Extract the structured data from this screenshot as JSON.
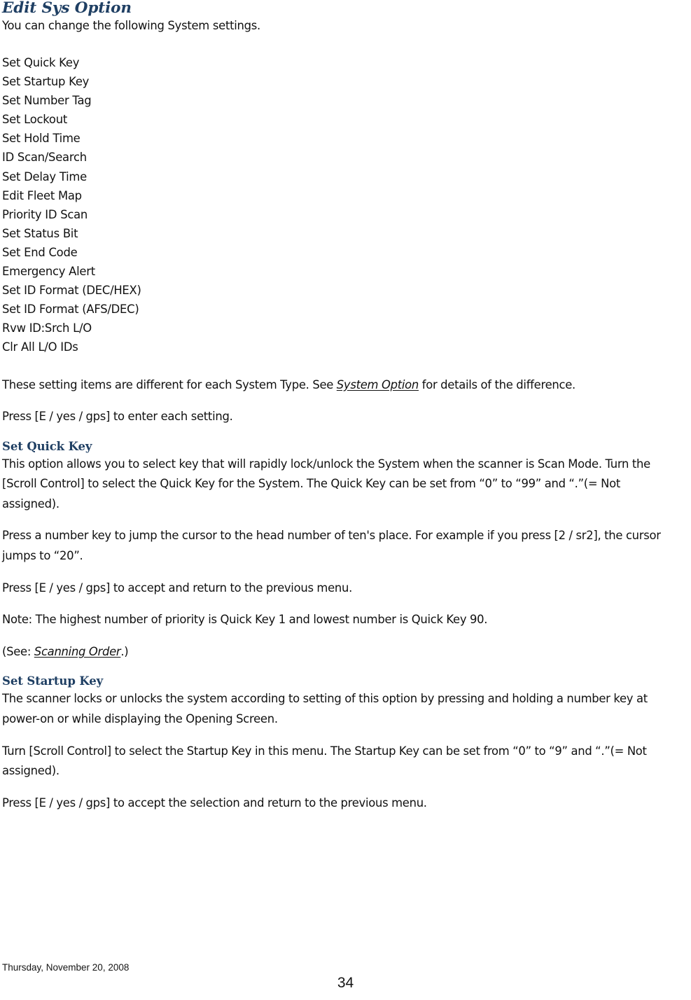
{
  "document": {
    "title": "Edit Sys Option",
    "intro": "You can change the following System settings.",
    "option_list": [
      "Set Quick Key",
      "Set Startup Key",
      "Set Number Tag",
      "Set Lockout",
      "Set Hold Time",
      "ID Scan/Search",
      "Set Delay Time",
      "Edit Fleet Map",
      "Priority ID Scan",
      "Set Status Bit",
      "Set End Code",
      "Emergency Alert",
      "Set ID Format (DEC/HEX)",
      "Set ID Format (AFS/DEC)",
      "Rvw ID:Srch L/O",
      "Clr All L/O IDs"
    ],
    "after_list": {
      "difference_note_before": "These setting items are different for each System Type. See ",
      "difference_note_link": "System Option",
      "difference_note_after": " for details of the difference.",
      "enter_setting": "Press [E / yes / gps] to enter each setting."
    },
    "sections": [
      {
        "heading": "Set Quick Key",
        "paragraphs": [
          "This option allows you to select key that will rapidly lock/unlock the System when the scanner is Scan Mode. Turn the [Scroll Control] to select the Quick Key for the System. The Quick Key can be set from “0” to “99” and “.”(= Not assigned).",
          "Press a number key to jump the cursor to the head number of ten's place. For example if you press [2 / sr2], the cursor jumps to “20”.",
          "Press [E / yes / gps] to accept and return to the previous menu.",
          "Note: The highest number of priority is Quick Key 1 and lowest number is Quick Key 90."
        ],
        "see_also_before": "(See: ",
        "see_also_link": "Scanning Order",
        "see_also_after": ".)"
      },
      {
        "heading": "Set Startup Key",
        "paragraphs": [
          "The scanner locks or unlocks the system according to setting of this option by pressing and holding a number key at power-on or while displaying the Opening Screen.",
          "Turn [Scroll Control] to select the Startup Key in this menu. The Startup Key can be set from “0” to “9” and “.”(= Not assigned).",
          "Press [E / yes / gps] to accept the selection and return to the previous menu."
        ]
      }
    ]
  },
  "footer": {
    "date": "Thursday, November 20, 2008",
    "page_number": "34"
  },
  "colors": {
    "heading": "#1F3F63",
    "body": "#111111",
    "background": "#ffffff"
  }
}
